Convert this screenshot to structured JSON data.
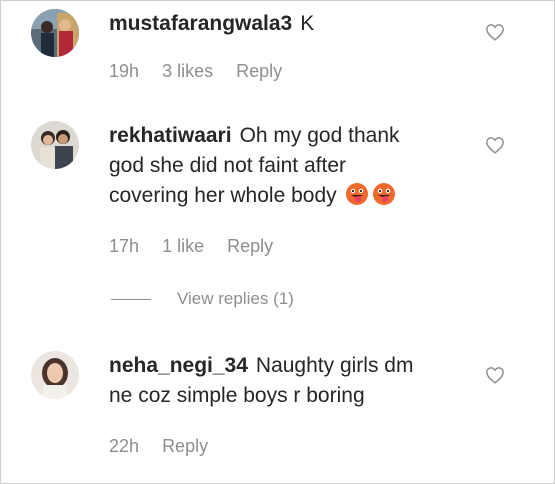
{
  "comments": [
    {
      "username": "mustafarangwala3",
      "text": "K",
      "time": "19h",
      "likes": "3 likes",
      "reply": "Reply",
      "avatar_icon": "user-avatar"
    },
    {
      "username": "rekhatiwaari",
      "text_line1": "Oh my god thank",
      "text_line2": "god she did not faint after",
      "text_line3": "covering her whole body",
      "emoji_icon": "tongue-out-winking-face-icon",
      "time": "17h",
      "likes": "1 like",
      "reply": "Reply",
      "avatar_icon": "user-avatar"
    },
    {
      "username": "neha_negi_34",
      "text_line1": "Naughty girls dm",
      "text_line2": "ne coz simple boys r boring",
      "time": "22h",
      "reply": "Reply",
      "avatar_icon": "user-avatar"
    }
  ],
  "view_replies": "View replies (1)",
  "colors": {
    "text": "#262626",
    "meta": "#8e8e8e",
    "heart": "#8e8e8e"
  }
}
